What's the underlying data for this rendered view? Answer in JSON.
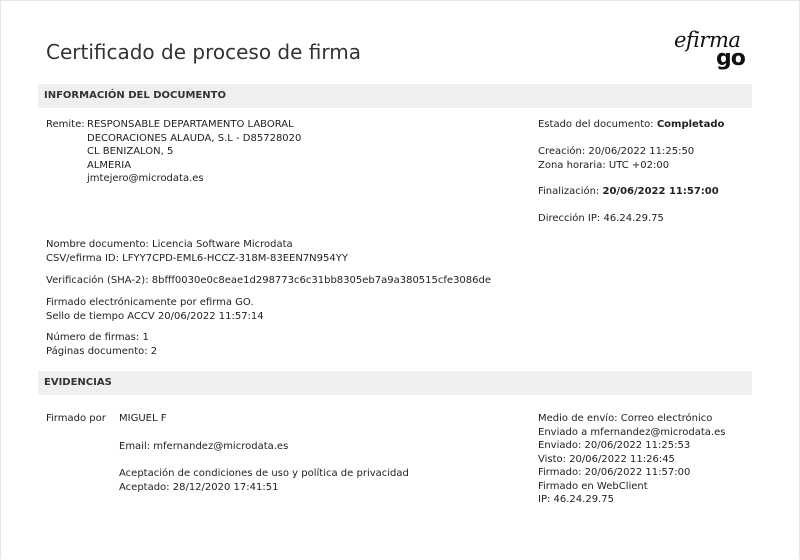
{
  "header": {
    "title": "Certificado de proceso de firma",
    "logo_top": "efirma",
    "logo_bottom": "go"
  },
  "doc_info": {
    "section_title": "INFORMACIÓN DEL DOCUMENTO",
    "remitente_label": "Remite:",
    "remitente_lines": [
      "RESPONSABLE DEPARTAMENTO LABORAL",
      "DECORACIONES ALAUDA, S.L - D85728020",
      "CL BENIZALON, 5",
      "ALMERIA",
      "jmtejero@microdata.es"
    ],
    "estado_label": "Estado del documento:",
    "estado_value": "Completado",
    "creacion": "Creación: 20/06/2022 11:25:50",
    "zona_horaria": "Zona horaria: UTC +02:00",
    "finalizacion_label": "Finalización:",
    "finalizacion_value": "20/06/2022 11:57:00",
    "direccion_ip": "Dirección IP: 46.24.29.75",
    "nombre_documento": "Nombre documento: Licencia Software Microdata",
    "csv": "CSV/efirma ID: LFYY7CPD-EML6-HCCZ-318M-83EEN7N954YY",
    "verificacion": "Verificación (SHA-2): 8bfff0030e0c8eae1d298773c6c31bb8305eb7a9a380515cfe3086de",
    "firmado_electronicamente": "Firmado electrónicamente por efirma GO.",
    "sello_tiempo": "Sello de tiempo ACCV 20/06/2022 11:57:14",
    "numero_firmas": "Número de firmas: 1",
    "paginas_documento": "Páginas documento: 2"
  },
  "evidencias": {
    "section_title": "EVIDENCIAS",
    "firmado_por_label": "Firmado por",
    "firmante": "MIGUEL F",
    "email": "Email: mfernandez@microdata.es",
    "aceptacion": "Aceptación de condiciones de uso y política de privacidad",
    "aceptado": "Aceptado: 28/12/2020 17:41:51",
    "envio_lines": [
      "Medio de envío: Correo electrónico",
      "Enviado a mfernandez@microdata.es",
      "Enviado: 20/06/2022 11:25:53",
      "Visto: 20/06/2022 11:26:45",
      "Firmado: 20/06/2022 11:57:00",
      "Firmado en WebClient",
      "IP: 46.24.29.75"
    ]
  }
}
